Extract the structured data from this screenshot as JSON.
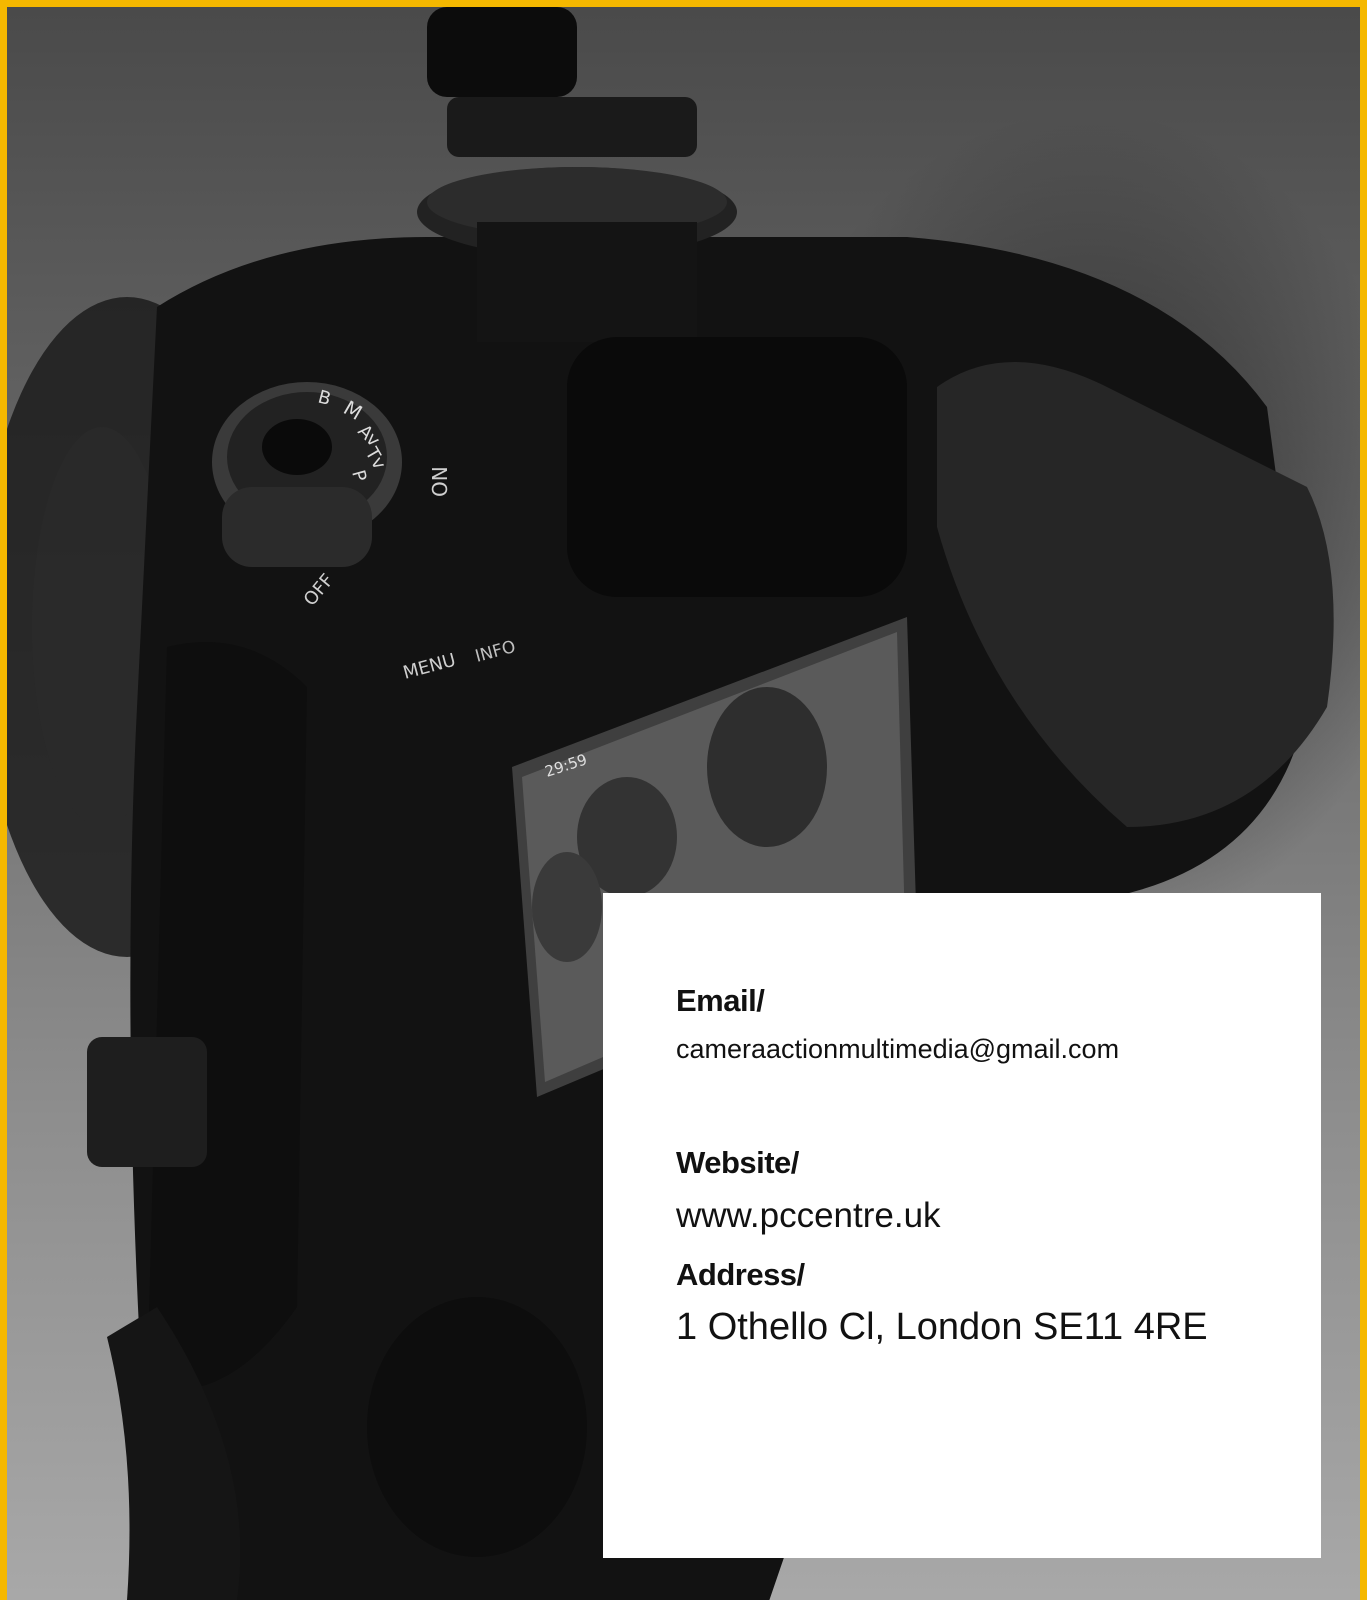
{
  "photo": {
    "camera_dial_labels": [
      "M",
      "Av",
      "Tv",
      "P",
      "B"
    ],
    "camera_power_labels": [
      "ON",
      "OFF"
    ],
    "camera_button_labels": [
      "MENU",
      "INFO"
    ],
    "camera_screen_readout": "29:59"
  },
  "contact": {
    "email_label": "Email/",
    "email_value": "cameraactionmultimedia@gmail.com",
    "website_label": "Website/",
    "website_value": "www.pccentre.uk",
    "address_label": "Address/",
    "address_value": "1 Othello Cl, London SE11 4RE"
  },
  "colors": {
    "frame_border": "#f5b800",
    "card_background": "#ffffff",
    "text": "#111111"
  }
}
